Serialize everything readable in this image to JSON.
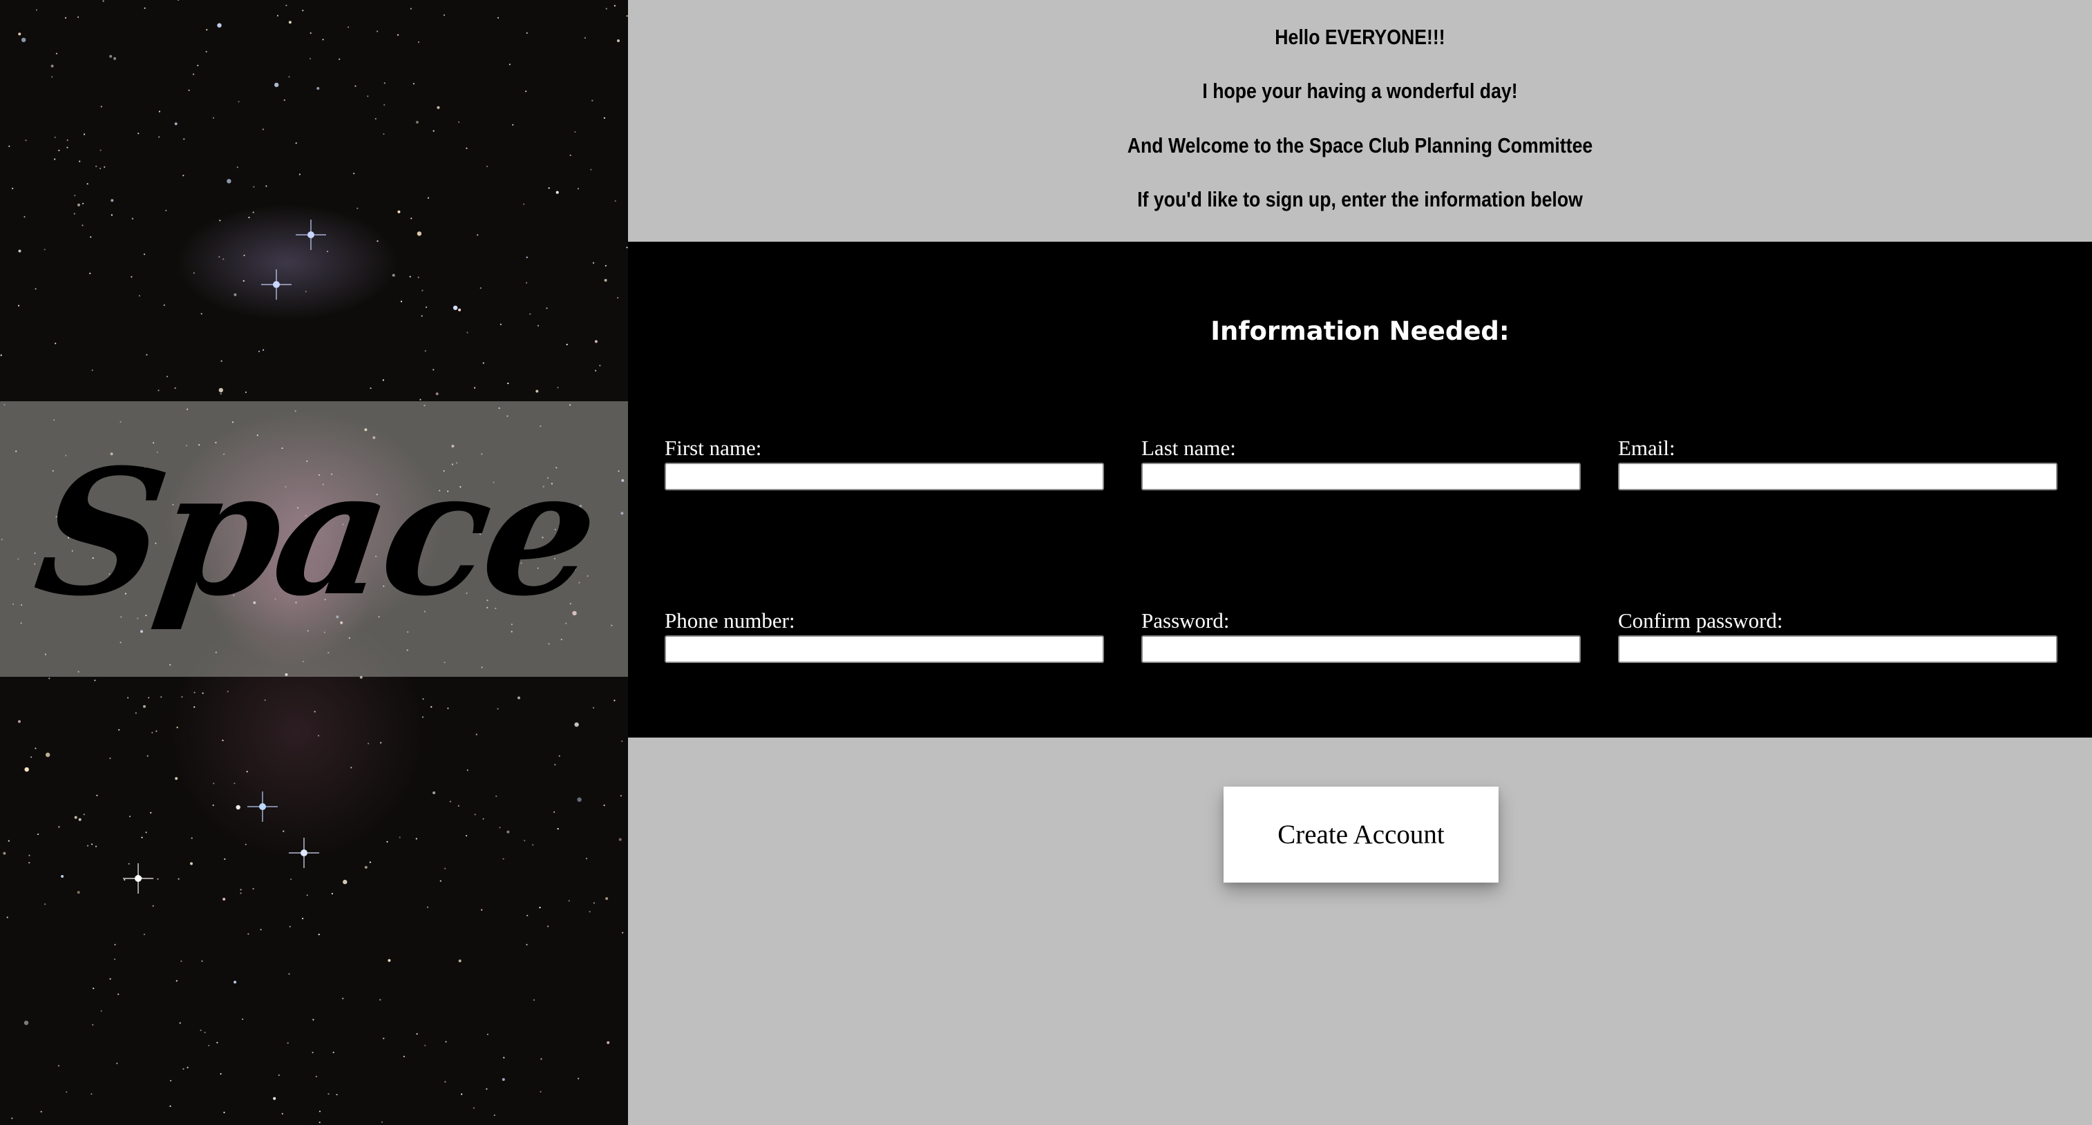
{
  "sidebar": {
    "title": "Space"
  },
  "header": {
    "line1": "Hello EVERYONE!!!",
    "line2": "I hope your having a wonderful day!",
    "line3": "And Welcome to the Space Club Planning Committee",
    "line4": "If you'd like to sign up, enter the information below"
  },
  "form": {
    "heading": "Information Needed:",
    "fields": [
      {
        "label": "First name:",
        "value": ""
      },
      {
        "label": "Last name:",
        "value": ""
      },
      {
        "label": "Email:",
        "value": ""
      },
      {
        "label": "Phone number:",
        "value": ""
      },
      {
        "label": "Password:",
        "value": ""
      },
      {
        "label": "Confirm password:",
        "value": ""
      }
    ],
    "submit_label": "Create Account"
  },
  "colors": {
    "content_background": "#bfbfbf",
    "form_background": "#000000",
    "button_background": "#ffffff"
  }
}
